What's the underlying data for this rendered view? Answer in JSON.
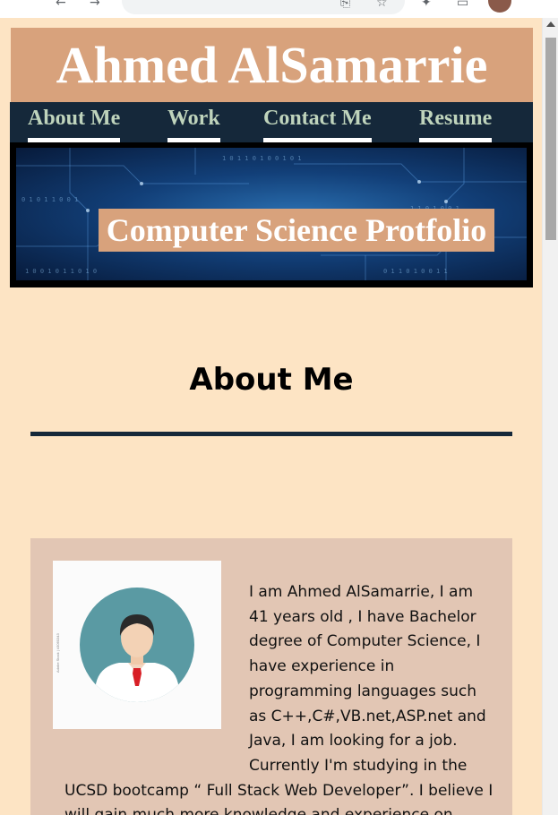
{
  "site": {
    "title": "Ahmed AlSamarrie",
    "nav": [
      {
        "label": "About Me"
      },
      {
        "label": "Work"
      },
      {
        "label": "Contact Me"
      },
      {
        "label": "Resume"
      }
    ],
    "hero_caption": "Computer Science Protfolio"
  },
  "about": {
    "heading": "About Me",
    "photo_watermark": "Adobe Stock | #3060343",
    "bio": "I am Ahmed AlSamarrie, I am 41 years old , I have Bachelor degree of Computer Science, I have experience in programming languages such as C++,C#,VB.net,ASP.net and Java, I am looking for a job. Currently I'm studying in the UCSD bootcamp “ Full Stack Web Developer”. I believe I will gain much more knowledge and experience on HTML, CSS, JScript"
  },
  "colors": {
    "page_bg": "#fde4c4",
    "banner_bg": "#d8a27c",
    "nav_bg": "#15283a",
    "nav_text": "#bfd4bc",
    "card_bg": "#e2c6b4"
  },
  "icons": [
    "back-icon",
    "forward-icon",
    "reload-icon",
    "bookmark-star-icon",
    "share-icon",
    "extensions-icon",
    "profile-avatar"
  ]
}
